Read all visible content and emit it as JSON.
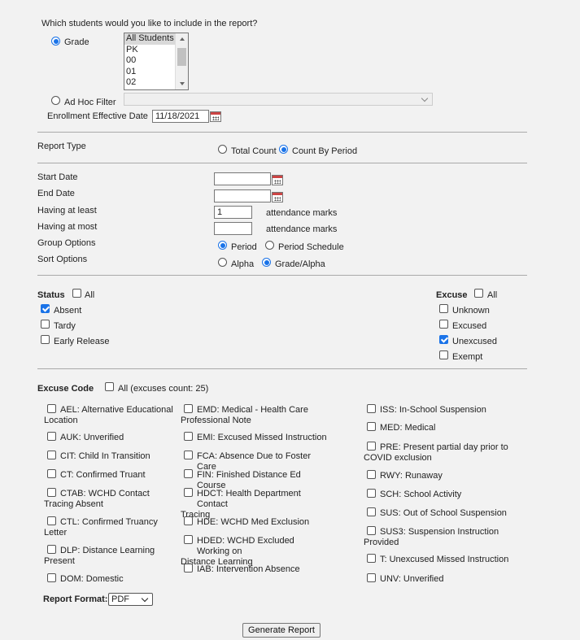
{
  "question": "Which students would you like to include in the report?",
  "grade_label": "Grade",
  "grade_options": [
    "All Students",
    "PK",
    "00",
    "01",
    "02"
  ],
  "adhoc_label": "Ad Hoc Filter",
  "enrollment_label": "Enrollment Effective Date",
  "enrollment_value": "11/18/2021",
  "report_type_label": "Report Type",
  "total_count_label": "Total Count",
  "count_by_period_label": "Count By Period",
  "start_date_label": "Start Date",
  "end_date_label": "End Date",
  "having_least_label": "Having at least",
  "having_least_value": "1",
  "having_most_label": "Having at most",
  "attendance_marks": "attendance marks",
  "group_options_label": "Group Options",
  "period_label": "Period",
  "period_schedule_label": "Period Schedule",
  "sort_options_label": "Sort Options",
  "alpha_label": "Alpha",
  "grade_alpha_label": "Grade/Alpha",
  "status": {
    "title": "Status",
    "all_label": "All",
    "items": [
      "Absent",
      "Tardy",
      "Early Release"
    ]
  },
  "excuse": {
    "title": "Excuse",
    "all_label": "All",
    "items": [
      "Unknown",
      "Excused",
      "Unexcused",
      "Exempt"
    ]
  },
  "excuse_code": {
    "title": "Excuse Code",
    "all_label": "All (excuses count: 25)",
    "col1": [
      [
        "AEL: Alternative Educational",
        "Location"
      ],
      [
        "AUK: Unverified",
        ""
      ],
      [
        "CIT: Child In Transition",
        ""
      ],
      [
        "CT: Confirmed Truant",
        ""
      ],
      [
        "CTAB: WCHD Contact",
        "Tracing Absent"
      ],
      [
        "CTL: Confirmed Truancy",
        "Letter"
      ],
      [
        "DLP: Distance Learning",
        "Present"
      ],
      [
        "DOM: Domestic",
        ""
      ]
    ],
    "col2": [
      [
        "EMD: Medical - Health Care",
        "Professional Note"
      ],
      [
        "EMI: Excused Missed Instruction",
        ""
      ],
      [
        "FCA: Absence Due to Foster Care",
        ""
      ],
      [
        "FIN: Finished Distance Ed Course",
        ""
      ],
      [
        "HDCT: Health Department Contact",
        "Tracing"
      ],
      [
        "HDE: WCHD Med Exclusion",
        ""
      ],
      [
        "HDED: WCHD Excluded Working on",
        "Distance Learning"
      ],
      [
        "IAB: Intervention Absence",
        ""
      ]
    ],
    "col3": [
      [
        "ISS: In-School Suspension",
        ""
      ],
      [
        "MED: Medical",
        ""
      ],
      [
        "PRE: Present partial day prior to",
        "COVID exclusion"
      ],
      [
        "RWY: Runaway",
        ""
      ],
      [
        "SCH: School Activity",
        ""
      ],
      [
        "SUS: Out of School Suspension",
        ""
      ],
      [
        "SUS3: Suspension Instruction",
        "Provided"
      ],
      [
        "T: Unexcused Missed Instruction",
        ""
      ],
      [
        "UNV: Unverified",
        ""
      ]
    ]
  },
  "report_format_label": "Report Format:",
  "report_format_value": "PDF",
  "generate_label": "Generate Report",
  "colors": {
    "accent": "#1a73e8",
    "background": "#f2f2f2"
  }
}
